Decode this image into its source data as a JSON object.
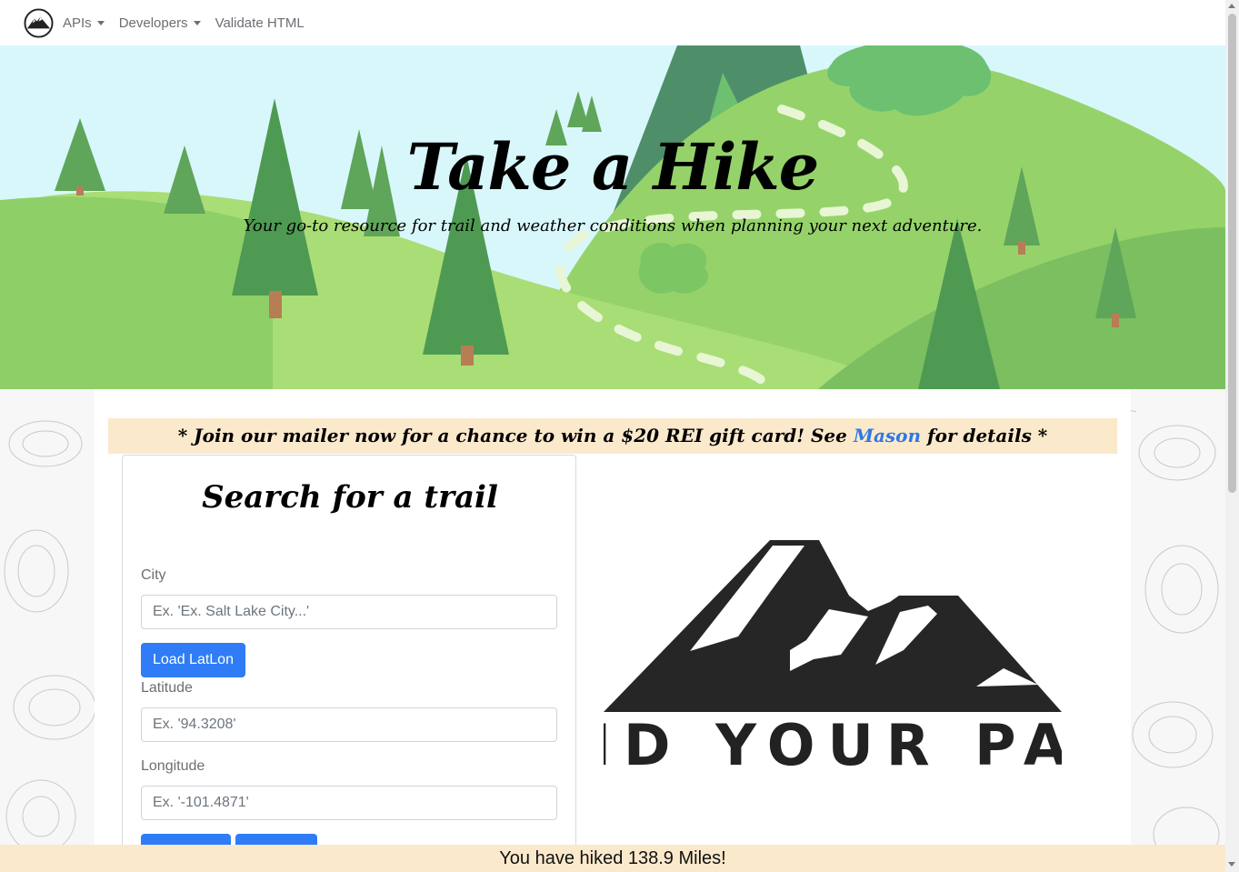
{
  "navbar": {
    "brand_icon": "mountain-logo-icon",
    "items": [
      {
        "label": "APIs",
        "dropdown": true
      },
      {
        "label": "Developers",
        "dropdown": true
      },
      {
        "label": "Validate HTML",
        "dropdown": false
      }
    ]
  },
  "hero": {
    "title": "Take a Hike",
    "subtitle": "Your go-to resource for trail and weather conditions when planning your next adventure."
  },
  "banner": {
    "prefix": "* Join our mailer now for a chance to win a $20 REI gift card! See ",
    "link_text": "Mason",
    "suffix": " for details *"
  },
  "search": {
    "title": "Search for a trail",
    "city_label": "City",
    "city_placeholder": "Ex. 'Ex. Salt Lake City...'",
    "load_button": "Load LatLon",
    "latitude_label": "Latitude",
    "latitude_placeholder": "Ex. '94.3208'",
    "longitude_label": "Longitude",
    "longitude_placeholder": "Ex. '-101.4871'"
  },
  "logo": {
    "text": "FIND YOUR PATH"
  },
  "footer": {
    "text": "You have hiked 138.9 Miles!"
  },
  "colors": {
    "accent": "#2f7cf6",
    "banner_bg": "#fbe9cc",
    "link": "#2f78e8"
  }
}
